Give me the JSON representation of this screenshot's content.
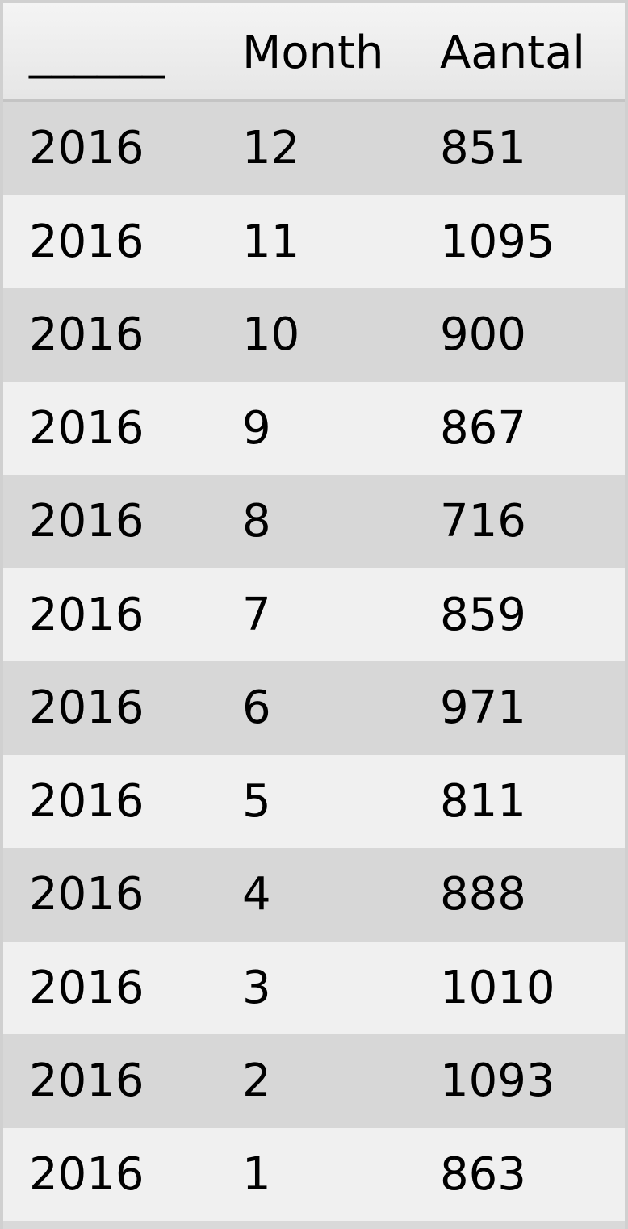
{
  "chart_data": {
    "type": "table",
    "columns": [
      "______",
      "Month",
      "Aantal"
    ],
    "rows": [
      [
        "2016",
        "12",
        "851"
      ],
      [
        "2016",
        "11",
        "1095"
      ],
      [
        "2016",
        "10",
        "900"
      ],
      [
        "2016",
        "9",
        "867"
      ],
      [
        "2016",
        "8",
        "716"
      ],
      [
        "2016",
        "7",
        "859"
      ],
      [
        "2016",
        "6",
        "971"
      ],
      [
        "2016",
        "5",
        "811"
      ],
      [
        "2016",
        "4",
        "888"
      ],
      [
        "2016",
        "3",
        "1010"
      ],
      [
        "2016",
        "2",
        "1093"
      ],
      [
        "2016",
        "1",
        "863"
      ]
    ]
  }
}
